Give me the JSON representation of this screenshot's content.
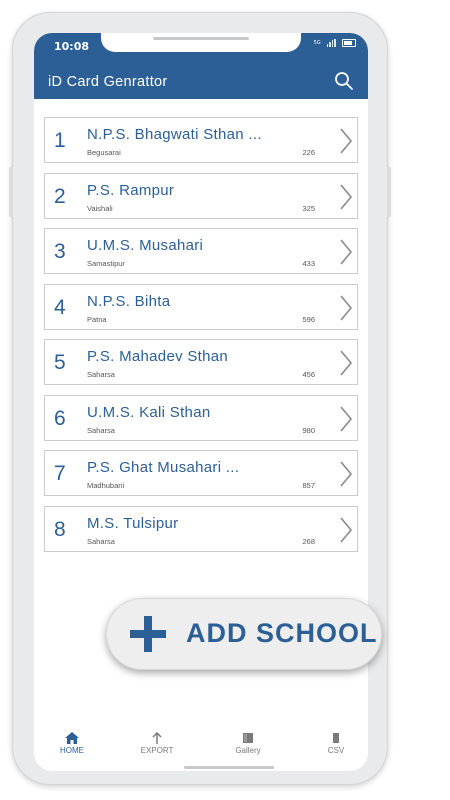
{
  "status_bar": {
    "time": "10:08",
    "network": "5G"
  },
  "app_bar": {
    "title": "iD Card Genrattor"
  },
  "schools": [
    {
      "number": "1",
      "name": "N.P.S. Bhagwati Sthan ...",
      "district": "Begusarai",
      "count": "226"
    },
    {
      "number": "2",
      "name": "P.S. Rampur",
      "district": "Vaishali",
      "count": "325"
    },
    {
      "number": "3",
      "name": "U.M.S. Musahari",
      "district": "Samastipur",
      "count": "433"
    },
    {
      "number": "4",
      "name": "N.P.S. Bihta",
      "district": "Patna",
      "count": "596"
    },
    {
      "number": "5",
      "name": "P.S. Mahadev Sthan",
      "district": "Saharsa",
      "count": "456"
    },
    {
      "number": "6",
      "name": "U.M.S. Kali Sthan",
      "district": "Saharsa",
      "count": "980"
    },
    {
      "number": "7",
      "name": "P.S. Ghat Musahari ...",
      "district": "Madhubani",
      "count": "857"
    },
    {
      "number": "8",
      "name": "M.S. Tulsipur",
      "district": "Saharsa",
      "count": "268"
    }
  ],
  "fab": {
    "label": "ADD SCHOOL"
  },
  "bottom_nav": [
    {
      "label": "HOME",
      "icon": "home-icon",
      "active": true
    },
    {
      "label": "EXPORT",
      "icon": "export-icon"
    },
    {
      "label": "Gallery",
      "icon": "gallery-icon"
    },
    {
      "label": "CSV",
      "icon": "csv-icon"
    }
  ],
  "colors": {
    "primary": "#2c5f96",
    "frame": "#e9eaec"
  }
}
